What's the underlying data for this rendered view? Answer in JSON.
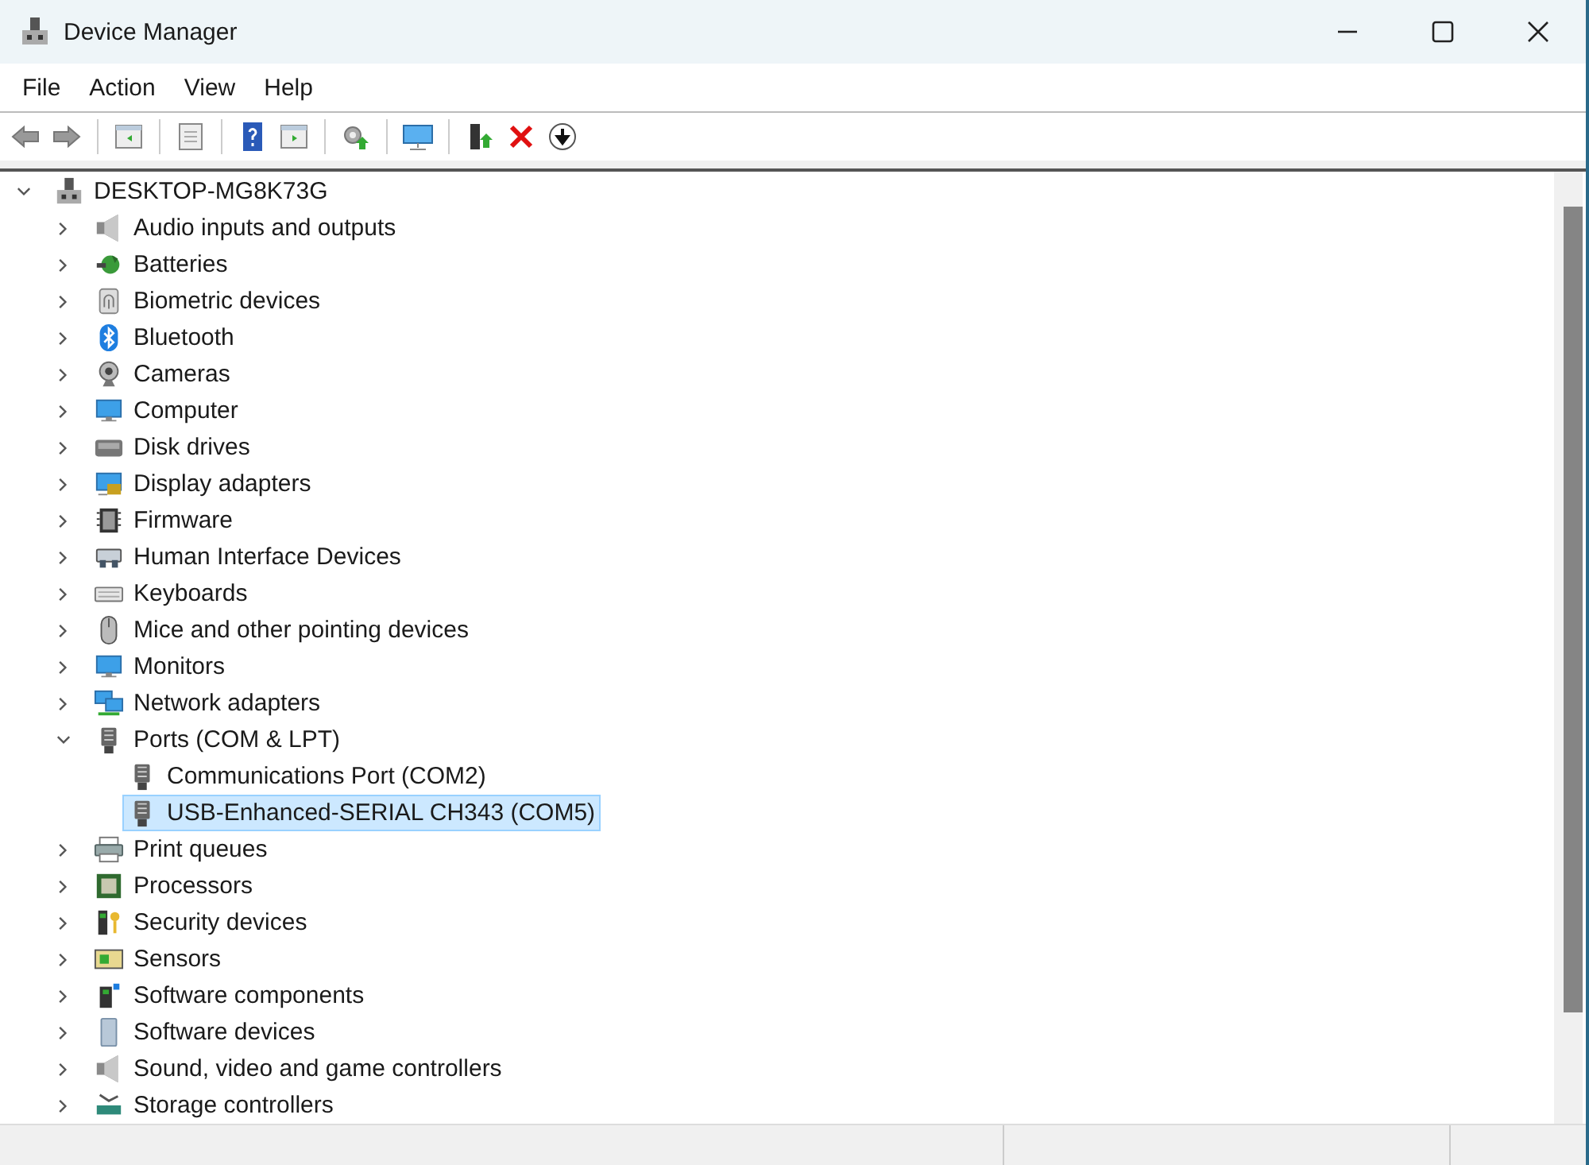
{
  "window": {
    "title": "Device Manager"
  },
  "menu": [
    "File",
    "Action",
    "View",
    "Help"
  ],
  "tree": {
    "label": "DESKTOP-MG8K73G",
    "expanded": true,
    "selected": false,
    "children": [
      {
        "label": "Audio inputs and outputs",
        "expanded": false,
        "selected": false
      },
      {
        "label": "Batteries",
        "expanded": false,
        "selected": false
      },
      {
        "label": "Biometric devices",
        "expanded": false,
        "selected": false
      },
      {
        "label": "Bluetooth",
        "expanded": false,
        "selected": false
      },
      {
        "label": "Cameras",
        "expanded": false,
        "selected": false
      },
      {
        "label": "Computer",
        "expanded": false,
        "selected": false
      },
      {
        "label": "Disk drives",
        "expanded": false,
        "selected": false
      },
      {
        "label": "Display adapters",
        "expanded": false,
        "selected": false
      },
      {
        "label": "Firmware",
        "expanded": false,
        "selected": false
      },
      {
        "label": "Human Interface Devices",
        "expanded": false,
        "selected": false
      },
      {
        "label": "Keyboards",
        "expanded": false,
        "selected": false
      },
      {
        "label": "Mice and other pointing devices",
        "expanded": false,
        "selected": false
      },
      {
        "label": "Monitors",
        "expanded": false,
        "selected": false
      },
      {
        "label": "Network adapters",
        "expanded": false,
        "selected": false
      },
      {
        "label": "Ports (COM & LPT)",
        "expanded": true,
        "selected": false,
        "children": [
          {
            "label": "Communications Port (COM2)",
            "selected": false
          },
          {
            "label": "USB-Enhanced-SERIAL CH343 (COM5)",
            "selected": true
          }
        ]
      },
      {
        "label": "Print queues",
        "expanded": false,
        "selected": false
      },
      {
        "label": "Processors",
        "expanded": false,
        "selected": false
      },
      {
        "label": "Security devices",
        "expanded": false,
        "selected": false
      },
      {
        "label": "Sensors",
        "expanded": false,
        "selected": false
      },
      {
        "label": "Software components",
        "expanded": false,
        "selected": false
      },
      {
        "label": "Software devices",
        "expanded": false,
        "selected": false
      },
      {
        "label": "Sound, video and game controllers",
        "expanded": false,
        "selected": false
      },
      {
        "label": "Storage controllers",
        "expanded": false,
        "selected": false
      }
    ]
  }
}
